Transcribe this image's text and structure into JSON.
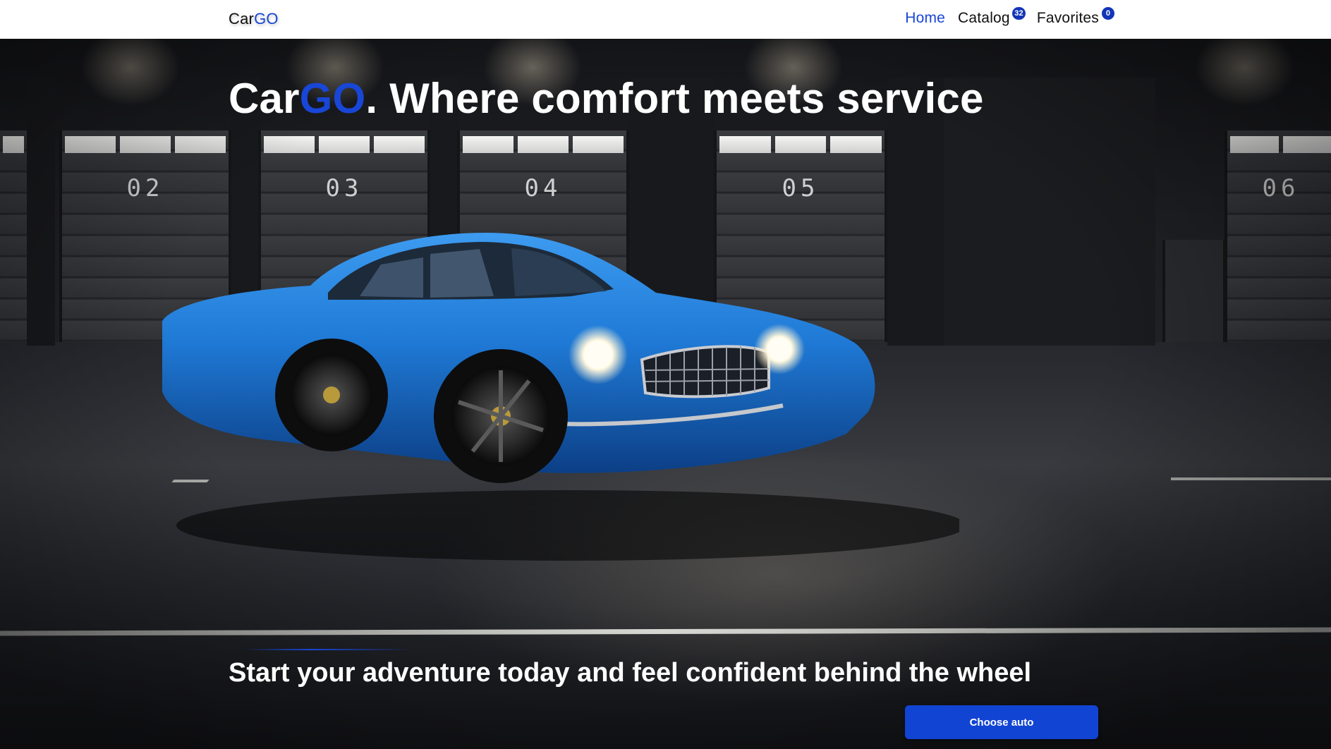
{
  "header": {
    "logo_text": "Car",
    "logo_accent": "GO",
    "nav": [
      {
        "label": "Home",
        "active": true
      },
      {
        "label": "Catalog",
        "badge": "32"
      },
      {
        "label": "Favorites",
        "badge": "0"
      }
    ]
  },
  "hero": {
    "title_prefix": "Car",
    "title_accent": "GO",
    "title_rest": ". Where comfort meets service",
    "subtitle": "Start your adventure today and feel confident behind the wheel",
    "cta_label": "Choose auto",
    "background_scene": {
      "door_numbers": [
        "02",
        "03",
        "04",
        "05",
        "06"
      ]
    }
  },
  "colors": {
    "accent": "#1846d6",
    "cta_background": "#1244d4",
    "car_blue": "#1f7ad6",
    "header_background": "#ffffff"
  }
}
